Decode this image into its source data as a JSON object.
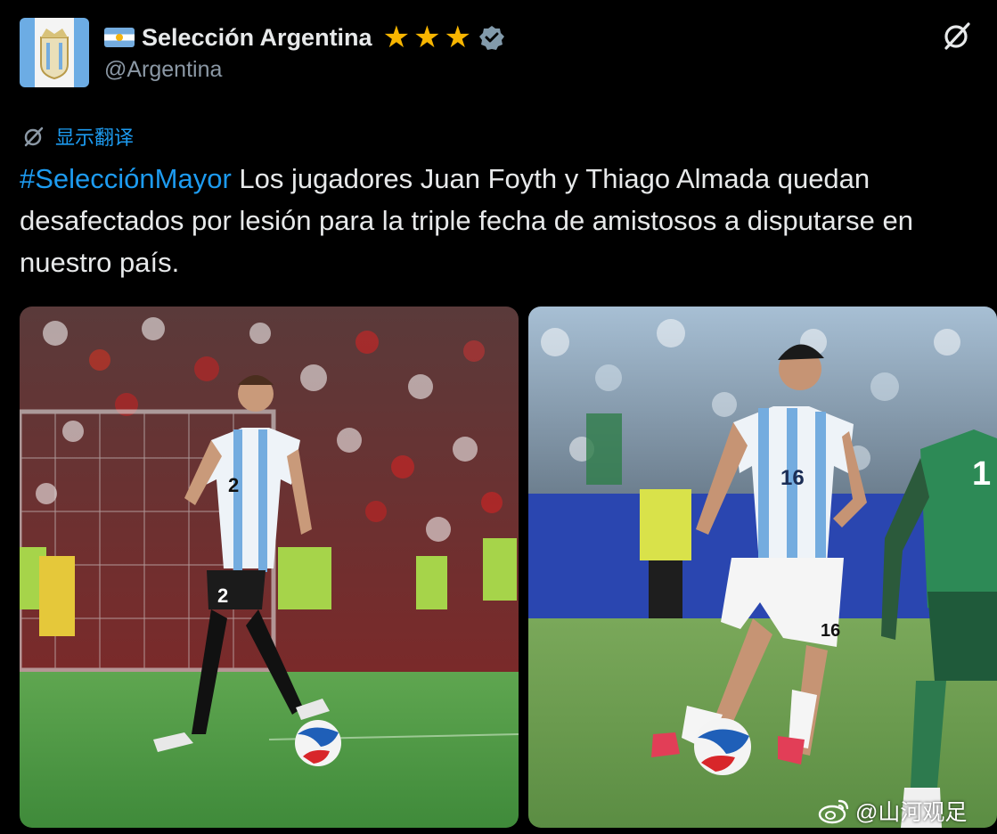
{
  "profile": {
    "display_name": "Selección Argentina",
    "handle": "@Argentina",
    "stars": [
      "★",
      "★",
      "★"
    ],
    "verified_icon": "verified-badge-icon",
    "flag_icon": "argentina-flag-icon"
  },
  "translate": {
    "label": "显示翻译"
  },
  "tweet": {
    "hashtag": "#SelecciónMayor",
    "text": " Los jugadores Juan Foyth y Thiago Almada quedan desafectados por lesión para la triple fecha de amistosos a disputarse en nuestro país."
  },
  "photos": {
    "left_shirt_number": "2",
    "left_shorts_number": "2",
    "right_shirt_number": "16",
    "right_shorts_number": "16",
    "opponent_number": "1"
  },
  "watermark": {
    "text": "@山河观足"
  },
  "colors": {
    "background": "#000000",
    "text": "#e7e9ea",
    "handle": "#8b98a5",
    "link": "#1d9bf0",
    "star": "#f7b500",
    "argentina_blue": "#74acdf"
  }
}
